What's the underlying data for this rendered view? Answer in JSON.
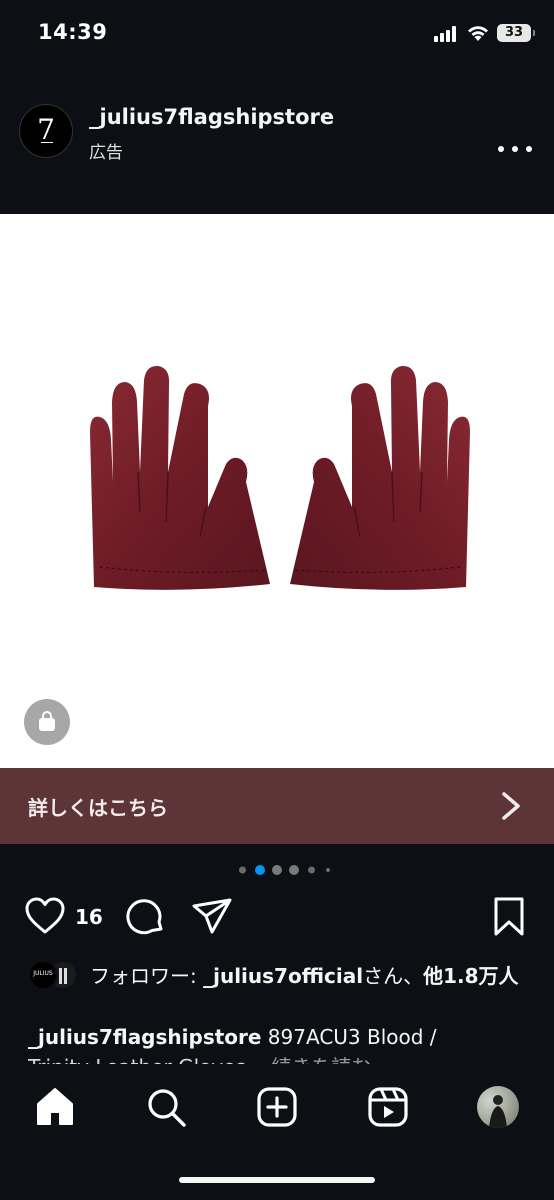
{
  "status_bar": {
    "time": "14:39",
    "battery_level": "33",
    "icons": [
      "signal-icon",
      "wifi-icon",
      "battery-icon"
    ]
  },
  "post": {
    "account_name": "_julius7flagshipstore",
    "avatar_text": "7",
    "sponsored_label": "広告",
    "media": {
      "description_icon": "gloves-image",
      "shop_icon": "shopping-bag-icon"
    },
    "cta": {
      "label": "詳しくはこちら",
      "background": "#5e3537",
      "icon": "chevron-right-icon"
    },
    "carousel": {
      "dot_count": 6,
      "active_index": 1,
      "active_color": "#0095f6"
    },
    "actions": {
      "like_count": "16",
      "icons": [
        "heart-icon",
        "comment-icon",
        "share-icon",
        "bookmark-icon"
      ]
    },
    "followers": {
      "prefix": "フォロワー: ",
      "follower_name": "_julius7official",
      "middle": "さん、",
      "others": "他1.8万人",
      "avatar_text": "JULIUS"
    },
    "caption": {
      "account": "_julius7flagshipstore",
      "text_line1": " 897ACU3 Blood /",
      "text_line2": "Trinity Leather Gloves",
      "more": "... 続きを読む"
    }
  },
  "tabbar": {
    "items": [
      "home-icon",
      "search-icon",
      "create-icon",
      "reels-icon",
      "profile-avatar"
    ]
  },
  "colors": {
    "background": "#0c1014",
    "text": "#f5f5f5",
    "accent": "#0095f6"
  }
}
